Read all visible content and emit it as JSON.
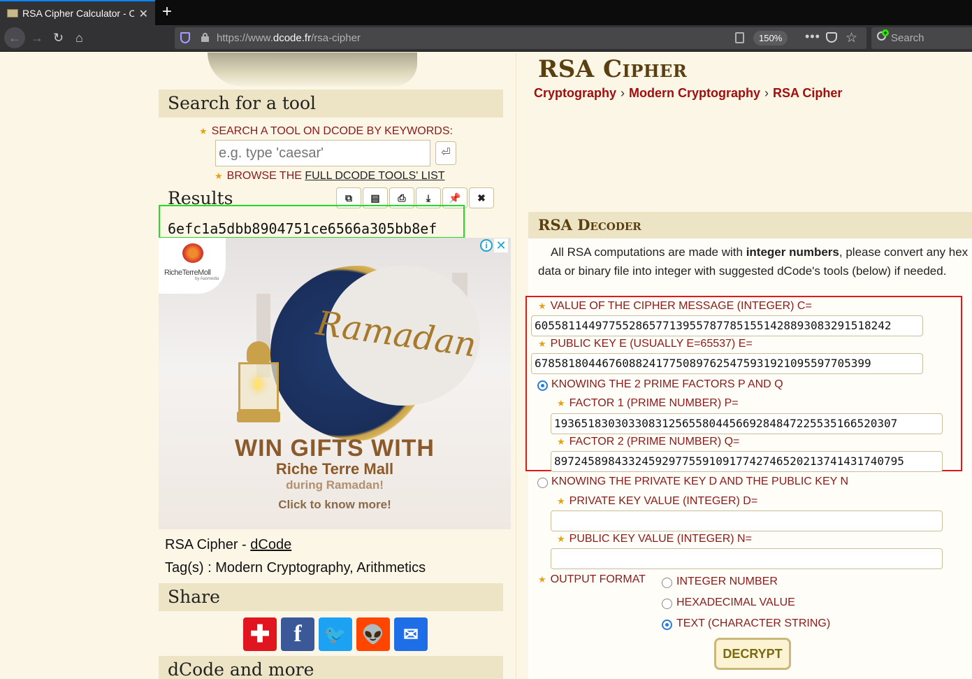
{
  "browser": {
    "tab_title": "RSA Cipher Calculator - O",
    "url_prefix": "https://www.",
    "url_domain": "dcode.fr",
    "url_path": "/rsa-cipher",
    "zoom": "150%",
    "search_placeholder": "Search"
  },
  "sidebar": {
    "search_heading": "Search for a tool",
    "keyword_label": "SEARCH A TOOL ON DCODE BY KEYWORDS:",
    "search_placeholder": "e.g. type 'caesar'",
    "browse_prefix": "BROWSE THE ",
    "browse_link": "FULL DCODE TOOLS' LIST",
    "results_heading": "Results",
    "result_value": "6efc1a5dbb8904751ce6566a305bb8ef",
    "ad": {
      "brand": "RicheTerreMoll",
      "brand_sub": "by Aasmedia",
      "script": "Ramadan",
      "headline": "WIN GIFTS WITH",
      "line1": "Riche Terre Mall",
      "line2": "during Ramadan!",
      "line3": "Click to know more!"
    },
    "tool_name_prefix": "RSA Cipher - ",
    "tool_name_link": "dCode",
    "tags": "Tag(s) : Modern Cryptography, Arithmetics",
    "share_heading": "Share",
    "more_heading": "dCode and more"
  },
  "main": {
    "title": "RSA Cipher",
    "breadcrumb": [
      "Cryptography",
      "Modern Cryptography",
      "RSA Cipher"
    ],
    "decoder_heading": "RSA Decoder",
    "intro_pre": "All RSA computations are made with ",
    "intro_bold": "integer numbers",
    "intro_post": ", please convert any hex data or binary file into integer with suggested dCode's tools (below) if needed.",
    "cipher_label": "VALUE OF THE CIPHER MESSAGE (INTEGER) C=",
    "cipher_value": "60558114497755286577139557877851551428893083291518242",
    "e_label": "PUBLIC KEY E (USUALLY E=65537) E=",
    "e_value": "67858180446760882417750897625475931921095597705399",
    "mode_pq_label": "KNOWING THE 2 PRIME FACTORS P AND Q",
    "p_label": "FACTOR 1 (PRIME NUMBER) P=",
    "p_value": "193651830303308312565580445669284847225535166520307",
    "q_label": "FACTOR 2 (PRIME NUMBER) Q=",
    "q_value": "8972458984332459297755910917742746520213741431740795",
    "mode_dn_label": "KNOWING THE PRIVATE KEY D AND THE PUBLIC KEY N",
    "d_label": "PRIVATE KEY VALUE (INTEGER) D=",
    "d_value": "",
    "n_label": "PUBLIC KEY VALUE (INTEGER) N=",
    "n_value": "",
    "output_label": "OUTPUT FORMAT",
    "output_options": [
      "INTEGER NUMBER",
      "HEXADECIMAL VALUE",
      "TEXT (CHARACTER STRING)"
    ],
    "output_selected": "TEXT (CHARACTER STRING)",
    "decrypt_label": "DECRYPT"
  }
}
